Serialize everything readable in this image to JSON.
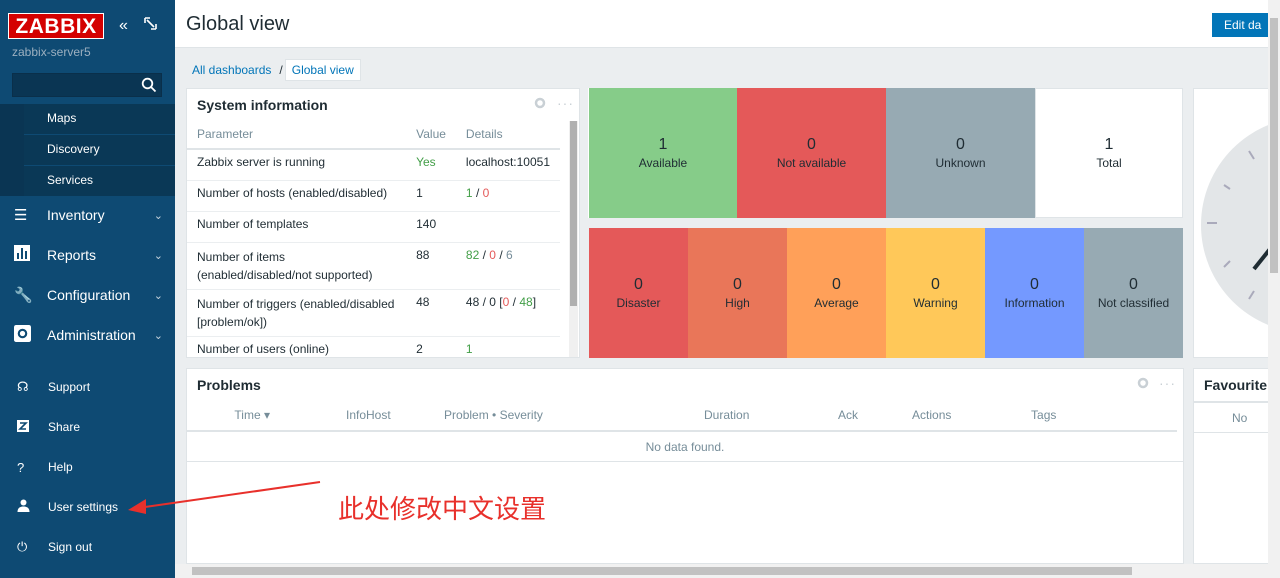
{
  "sidebar": {
    "logo": "ZABBIX",
    "server_name": "zabbix-server5",
    "search_placeholder": "",
    "submenu": [
      "Maps",
      "Discovery",
      "Services"
    ],
    "menu": [
      {
        "label": "Inventory",
        "icon": "list-icon"
      },
      {
        "label": "Reports",
        "icon": "bar-chart-icon"
      },
      {
        "label": "Configuration",
        "icon": "wrench-icon"
      },
      {
        "label": "Administration",
        "icon": "gear-icon"
      }
    ],
    "bottom": [
      {
        "label": "Support",
        "icon": "headset-icon"
      },
      {
        "label": "Share",
        "icon": "zabbix-share-icon"
      },
      {
        "label": "Help",
        "icon": "question-icon"
      },
      {
        "label": "User settings",
        "icon": "user-icon"
      },
      {
        "label": "Sign out",
        "icon": "power-icon"
      }
    ]
  },
  "header": {
    "title": "Global view",
    "edit_button": "Edit da"
  },
  "breadcrumb": {
    "root": "All dashboards",
    "separator": "/",
    "current": "Global view"
  },
  "system_info": {
    "title": "System information",
    "columns": [
      "Parameter",
      "Value",
      "Details"
    ],
    "rows": [
      {
        "param": "Zabbix server is running",
        "value": "Yes",
        "details": "localhost:10051"
      },
      {
        "param": "Number of hosts (enabled/disabled)",
        "value": "1",
        "d1": "1",
        "d2": "0"
      },
      {
        "param": "Number of templates",
        "value": "140"
      },
      {
        "param": "Number of items (enabled/disabled/not supported)",
        "value": "88",
        "d1": "82",
        "d2": "0",
        "d3": "6"
      },
      {
        "param": "Number of triggers (enabled/disabled [problem/ok])",
        "value": "48",
        "dprefix": "48 / 0 [",
        "d2": "0",
        "d3": "48",
        "dsuffix": "]"
      },
      {
        "param": "Number of users (online)",
        "value": "2",
        "d1": "1"
      }
    ]
  },
  "hosts": [
    {
      "count": "1",
      "label": "Available",
      "color": "#86cc89"
    },
    {
      "count": "0",
      "label": "Not available",
      "color": "#e45959"
    },
    {
      "count": "0",
      "label": "Unknown",
      "color": "#97aab3"
    },
    {
      "count": "1",
      "label": "Total",
      "color": "#ffffff"
    }
  ],
  "severities": [
    {
      "count": "0",
      "label": "Disaster",
      "color": "#e45959"
    },
    {
      "count": "0",
      "label": "High",
      "color": "#e97659"
    },
    {
      "count": "0",
      "label": "Average",
      "color": "#ffa059"
    },
    {
      "count": "0",
      "label": "Warning",
      "color": "#ffc859"
    },
    {
      "count": "0",
      "label": "Information",
      "color": "#7499ff"
    },
    {
      "count": "0",
      "label": "Not classified",
      "color": "#97aab3"
    }
  ],
  "problems": {
    "title": "Problems",
    "columns": [
      "Time ▾",
      "Info",
      "Host",
      "Problem • Severity",
      "Duration",
      "Ack",
      "Actions",
      "Tags"
    ],
    "empty": "No data found."
  },
  "favourites": {
    "title": "Favourite",
    "empty": "No"
  },
  "annotation": "此处修改中文设置"
}
